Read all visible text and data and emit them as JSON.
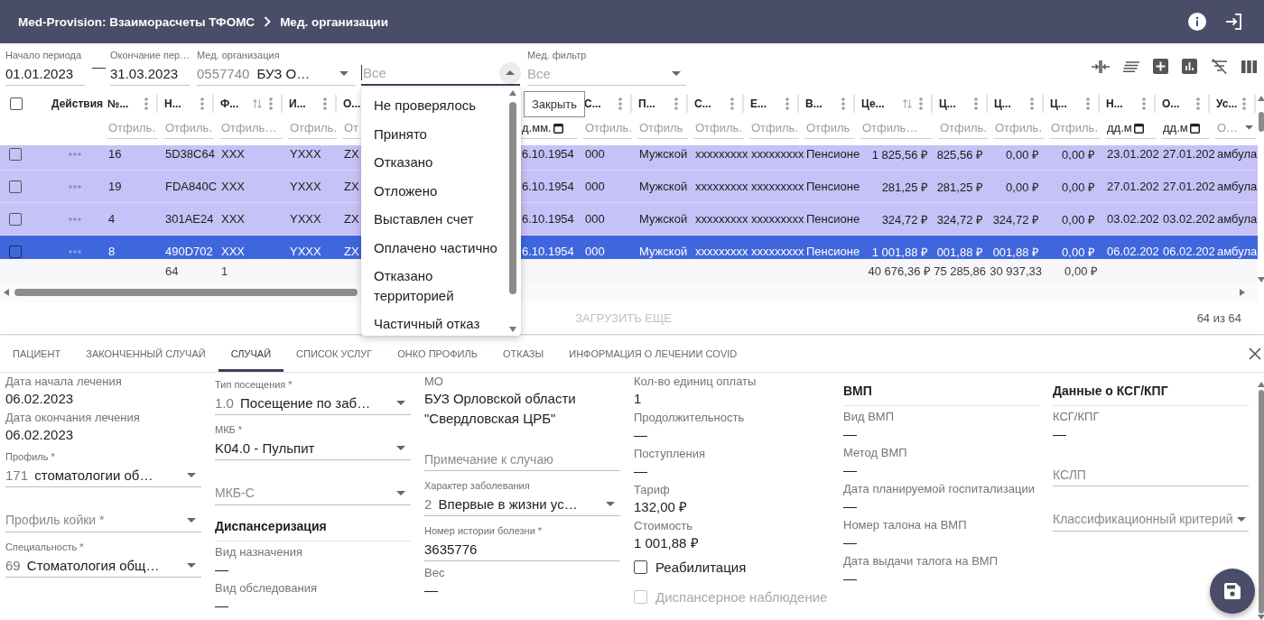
{
  "app_bar": {
    "title": "Med-Provision: Взаиморасчеты ТФОМС",
    "breadcrumb": "Мед. организации"
  },
  "filters": {
    "period_start": {
      "label": "Начало периода",
      "value": "01.01.2023"
    },
    "period_dash": "—",
    "period_end": {
      "label": "Окончание пер…",
      "value": "31.03.2023"
    },
    "organization": {
      "label": "Мед. организация",
      "code": "0557740",
      "value": "БУЗ О…"
    },
    "status": {
      "placeholder": "Все",
      "expanded": true,
      "tooltip": "Закрыть",
      "options": [
        {
          "label": "Не проверялось",
          "selected": false
        },
        {
          "label": "Принято",
          "selected": false
        },
        {
          "label": "Отказано",
          "selected": false
        },
        {
          "label": "Отложено",
          "selected": false
        },
        {
          "label": "Выставлен счет",
          "selected": false
        },
        {
          "label": "Оплачено частично",
          "selected": false
        },
        {
          "label": "Отказано территорией",
          "selected": false
        },
        {
          "label": "Частичный отказ",
          "selected": false
        }
      ]
    },
    "med_filter": {
      "label": "Мед. фильтр",
      "placeholder": "Все"
    }
  },
  "table": {
    "select_all": {
      "checked": false
    },
    "actions_title": "Действия",
    "columns": [
      {
        "title": "№...",
        "kind": "text",
        "menu": true,
        "sortable": false,
        "filter": {
          "kind": "text",
          "placeholder": "Отфиль."
        }
      },
      {
        "title": "Н...",
        "kind": "text",
        "menu": true,
        "sortable": false,
        "filter": {
          "kind": "text",
          "placeholder": "Отфиль."
        },
        "total": "64"
      },
      {
        "title": "Ф...",
        "kind": "text",
        "menu": true,
        "sortable": true,
        "filter": {
          "kind": "text",
          "placeholder": "Отфиль…"
        },
        "total": "1"
      },
      {
        "title": "И...",
        "kind": "text",
        "menu": true,
        "sortable": false,
        "filter": {
          "kind": "text",
          "placeholder": "Отфиль."
        }
      },
      {
        "title": "О...",
        "kind": "text",
        "filter": {
          "kind": "text",
          "placeholder": "От"
        }
      },
      {
        "kind": "text",
        "filter": {
          "kind": "date",
          "placeholder": "д.мм."
        }
      },
      {
        "title": "С...",
        "kind": "text",
        "menu": true,
        "sortable": false,
        "filter": {
          "kind": "text",
          "placeholder": "Отфиль."
        }
      },
      {
        "title": "П...",
        "kind": "text",
        "menu": true,
        "sortable": false,
        "filter": {
          "kind": "text",
          "placeholder": "Отфиль"
        }
      },
      {
        "title": "С...",
        "kind": "text",
        "menu": true,
        "sortable": false,
        "filter": {
          "kind": "text",
          "placeholder": "Отфиль."
        }
      },
      {
        "title": "Е...",
        "kind": "text",
        "menu": true,
        "sortable": false,
        "filter": {
          "kind": "text",
          "placeholder": "Отфиль."
        }
      },
      {
        "title": "В...",
        "kind": "text",
        "menu": true,
        "sortable": false,
        "filter": {
          "kind": "text",
          "placeholder": "Отфиль"
        }
      },
      {
        "title": "Це...",
        "kind": "money",
        "menu": true,
        "sortable": true,
        "filter": {
          "kind": "text",
          "placeholder": "Отфиль…"
        },
        "total": "40 676,36 ₽"
      },
      {
        "title": "Ц...",
        "kind": "money",
        "menu": true,
        "sortable": false,
        "filter": {
          "kind": "text",
          "placeholder": "Отфиль."
        },
        "total": "75 285,86"
      },
      {
        "title": "Ц...",
        "kind": "money",
        "menu": true,
        "sortable": false,
        "filter": {
          "kind": "text",
          "placeholder": "Отфиль."
        },
        "total": "30 937,33"
      },
      {
        "title": "Ц...",
        "kind": "money",
        "menu": true,
        "sortable": false,
        "filter": {
          "kind": "text",
          "placeholder": "Отфиль."
        },
        "total": "0,00 ₽"
      },
      {
        "title": "Н...",
        "kind": "text",
        "menu": true,
        "sortable": false,
        "filter": {
          "kind": "date",
          "placeholder": "дд.м"
        }
      },
      {
        "title": "О...",
        "kind": "text",
        "menu": true,
        "sortable": false,
        "filter": {
          "kind": "date",
          "placeholder": "дд.м"
        }
      },
      {
        "title": "Ус...",
        "kind": "text",
        "menu": true,
        "sortable": false,
        "filter": {
          "kind": "select",
          "placeholder": "О…"
        }
      }
    ],
    "rows": [
      {
        "checked": false,
        "selected": false,
        "cells": [
          "16",
          "5D38C64",
          "XXX",
          "YXXX",
          "ZX",
          "6.10.1954",
          "000",
          "Мужской",
          "xxxxxxxxx",
          "xxxxxxxxx",
          "Пенсионе",
          "1 825,56 ₽",
          "825,56 ₽",
          "0,00 ₽",
          "0,00 ₽",
          "23.01.202",
          "27.01.202",
          "амбула"
        ]
      },
      {
        "checked": false,
        "selected": false,
        "cells": [
          "19",
          "FDA840C",
          "XXX",
          "YXXX",
          "ZX",
          "6.10.1954",
          "000",
          "Мужской",
          "xxxxxxxxx",
          "xxxxxxxxx",
          "Пенсионе",
          "281,25 ₽",
          "281,25 ₽",
          "0,00 ₽",
          "0,00 ₽",
          "27.01.202",
          "27.01.202",
          "амбула"
        ]
      },
      {
        "checked": false,
        "selected": false,
        "cells": [
          "4",
          "301AE24",
          "XXX",
          "YXXX",
          "ZX",
          "6.10.1954",
          "000",
          "Мужской",
          "xxxxxxxxx",
          "xxxxxxxxx",
          "Пенсионе",
          "324,72 ₽",
          "324,72 ₽",
          "324,72 ₽",
          "0,00 ₽",
          "03.02.202",
          "03.02.202",
          "амбула"
        ]
      },
      {
        "checked": false,
        "selected": true,
        "cells": [
          "8",
          "490D702",
          "XXX",
          "YXXX",
          "ZX",
          "6.10.1954",
          "000",
          "Мужской",
          "xxxxxxxxx",
          "xxxxxxxxx",
          "Пенсионе",
          "1 001,88 ₽",
          "001,88 ₽",
          "001,88 ₽",
          "0,00 ₽",
          "06.02.202",
          "06.02.202",
          "амбула"
        ]
      }
    ]
  },
  "load_more": {
    "label": "ЗАГРУЗИТЬ ЕЩЕ",
    "disabled": true
  },
  "record_count": "64 из 64",
  "tabs": [
    {
      "label": "ПАЦИЕНТ",
      "selected": false
    },
    {
      "label": "ЗАКОНЧЕННЫЙ СЛУЧАЙ",
      "selected": false
    },
    {
      "label": "СЛУЧАЙ",
      "selected": true
    },
    {
      "label": "СПИСОК УСЛУГ",
      "selected": false
    },
    {
      "label": "ОНКО ПРОФИЛЬ",
      "selected": false
    },
    {
      "label": "ОТКАЗЫ",
      "selected": false
    },
    {
      "label": "ИНФОРМАЦИЯ О ЛЕЧЕНИИ COVID",
      "selected": false
    }
  ],
  "case_form": {
    "columns": [
      {
        "fields": [
          {
            "kind": "readonly",
            "label": "Дата начала лечения",
            "value": "06.02.2023"
          },
          {
            "kind": "readonly",
            "label": "Дата окончания лечения",
            "value": "06.02.2023"
          },
          {
            "kind": "select",
            "label": "Профиль *",
            "code": "171",
            "value": "стоматологии об…"
          },
          {
            "kind": "select",
            "placeholder": "Профиль койки *"
          },
          {
            "kind": "select",
            "label": "Специальность *",
            "code": "69",
            "value": "Стоматология общ…"
          }
        ]
      },
      {
        "fields": [
          {
            "kind": "select",
            "label": "Тип посещения *",
            "code": "1.0",
            "value": "Посещение по заб…"
          },
          {
            "kind": "select",
            "label": "МКБ *",
            "value": "K04.0 - Пульпит"
          },
          {
            "kind": "select",
            "placeholder": "МКБ-С"
          },
          {
            "kind": "heading",
            "text": "Диспансеризация"
          },
          {
            "kind": "readonly",
            "label": "Вид назначения",
            "value": "—"
          },
          {
            "kind": "readonly",
            "label": "Вид обследования",
            "value": "—"
          }
        ]
      },
      {
        "fields": [
          {
            "kind": "readonly",
            "label": "МО",
            "value": "БУЗ Орловской области \"Свердловская ЦРБ\""
          },
          {
            "kind": "text",
            "placeholder": "Примечание к случаю"
          },
          {
            "kind": "select",
            "label": "Характер заболевания",
            "code": "2",
            "value": "Впервые в жизни ус…"
          },
          {
            "kind": "text",
            "label": "Номер истории болезни *",
            "value": "3635776"
          },
          {
            "kind": "readonly",
            "label": "Вес",
            "value": "—"
          }
        ]
      },
      {
        "fields": [
          {
            "kind": "readonly",
            "label": "Кол-во единиц оплаты",
            "value": "1"
          },
          {
            "kind": "readonly",
            "label": "Продолжительность",
            "value": "—"
          },
          {
            "kind": "readonly",
            "label": "Поступления",
            "value": "—"
          },
          {
            "kind": "readonly",
            "label": "Тариф",
            "value": "132,00 ₽"
          },
          {
            "kind": "readonly",
            "label": "Стоимость",
            "value": "1 001,88 ₽"
          },
          {
            "kind": "checkbox",
            "label": "Реабилитация",
            "checked": false,
            "disabled": false
          },
          {
            "kind": "checkbox",
            "label": "Диспансерное наблюдение",
            "checked": false,
            "disabled": true
          }
        ]
      },
      {
        "fields": [
          {
            "kind": "heading",
            "text": "ВМП"
          },
          {
            "kind": "readonly",
            "label": "Вид ВМП",
            "value": "—"
          },
          {
            "kind": "readonly",
            "label": "Метод ВМП",
            "value": "—"
          },
          {
            "kind": "readonly",
            "label": "Дата планируемой госпитализации",
            "value": "—"
          },
          {
            "kind": "readonly",
            "label": "Номер талона на ВМП",
            "value": "—"
          },
          {
            "kind": "readonly",
            "label": "Дата выдачи талога на ВМП",
            "value": "—"
          }
        ]
      },
      {
        "fields": [
          {
            "kind": "heading",
            "text": "Данные о КСГ/КПГ"
          },
          {
            "kind": "readonly",
            "label": "КСГ/КПГ",
            "value": "—"
          },
          {
            "kind": "text",
            "placeholder": "КСЛП"
          },
          {
            "kind": "select",
            "placeholder": "Классификационный критерий"
          }
        ]
      }
    ]
  }
}
